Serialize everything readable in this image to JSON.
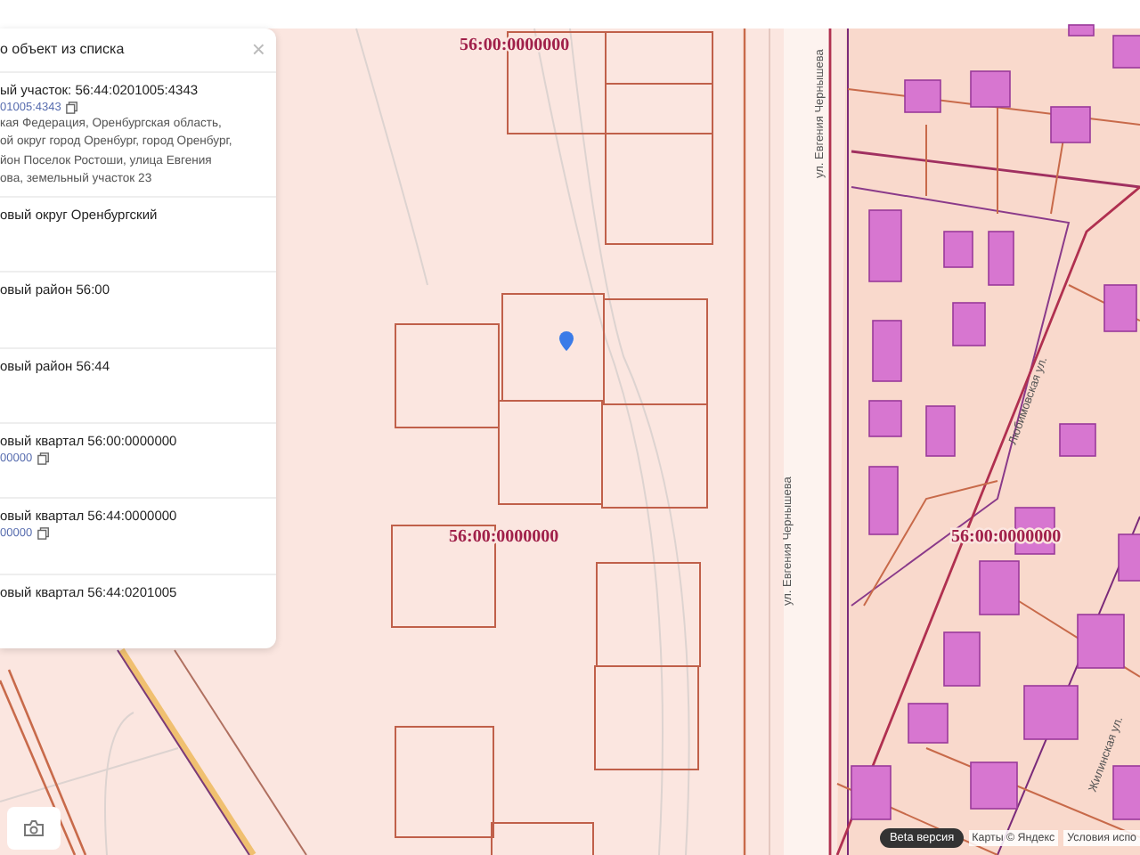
{
  "panel": {
    "title": "о объект из списка",
    "close": "×",
    "sections": [
      {
        "title": "ый участок: 56:44:0201005:4343",
        "link": "01005:4343",
        "address_lines": [
          "кая Федерация, Оренбургская область,",
          "ой округ город Оренбург, город Оренбург,",
          "йон Поселок Ростоши, улица Евгения",
          "ова, земельный участок 23"
        ]
      },
      {
        "title": "овый округ Оренбургский"
      },
      {
        "title": "овый район 56:00"
      },
      {
        "title": "овый район 56:44"
      },
      {
        "title": "овый квартал 56:00:0000000",
        "link": "00000"
      },
      {
        "title": "овый квартал 56:44:0000000",
        "link": "00000"
      },
      {
        "title": "овый квартал 56:44:0201005"
      }
    ]
  },
  "map": {
    "labels": [
      {
        "kind": "cadastral",
        "text": "56:00:0000000"
      },
      {
        "kind": "cadastral",
        "text": "56:00:0000000"
      },
      {
        "kind": "cadastral",
        "text": "56:00:0000000"
      },
      {
        "kind": "street",
        "text": "ул. Евгения Чернышева"
      },
      {
        "kind": "street",
        "text": "ул. Евгения Чернышева"
      },
      {
        "kind": "street",
        "text": "Любимовская ул."
      },
      {
        "kind": "street",
        "text": "Жилинская ул."
      }
    ]
  },
  "footer": {
    "badge": "Beta версия",
    "copyright": "Карты © Яндекс",
    "terms": "Условия испо"
  }
}
